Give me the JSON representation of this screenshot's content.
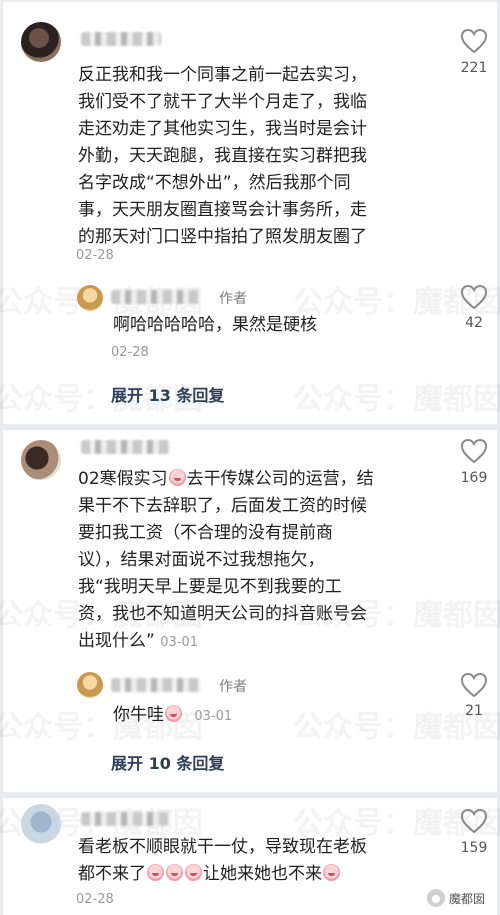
{
  "watermark": {
    "text": "魔都囡",
    "prefix": "公众号："
  },
  "comments": [
    {
      "text_lines": [
        "反正我和我一个同事之前一起去实习，",
        "我们受不了就干了大半个月走了，我临",
        "走还劝走了其他实习生，我当时是会计",
        "外勤，天天跑腿，我直接在实习群把我",
        "名字改成“不想外出”，然后我那个同",
        "事，天天朋友圈直接骂会计事务所，走",
        "的那天对门口竖中指拍了照发朋友圈了"
      ],
      "date": "02-28",
      "likes": "221",
      "reply": {
        "author_tag": "作者",
        "text": "啊哈哈哈哈哈，果然是硬核",
        "date": "02-28",
        "likes": "42"
      },
      "expand_label": "展开 13 条回复"
    },
    {
      "text_lines": [
        "02寒假实习",
        "去干传媒公司的运营，结",
        "果干不下去辞职了，后面发工资的时候",
        "要扣我工资（不合理的没有提前商",
        "议），结果对面说不过我想拖欠，",
        "我“我明天早上要是见不到我要的工",
        "资，我也不知道明天公司的抖音账号会",
        "出现什么”"
      ],
      "date": "03-01",
      "likes": "169",
      "reply": {
        "author_tag": "作者",
        "text": "你牛哇",
        "date": "03-01",
        "likes": "21"
      },
      "expand_label": "展开 10 条回复"
    },
    {
      "text_lines": [
        "看老板不顺眼就干一仗，导致现在老板",
        "都不来了",
        "让她来她也不来"
      ],
      "date": "02-28",
      "likes": "159"
    }
  ],
  "badge_text": "魔都囡",
  "colors": {
    "heart": "#8a8a8a",
    "expand": "#2f3e58",
    "date": "#9a9a9a"
  }
}
